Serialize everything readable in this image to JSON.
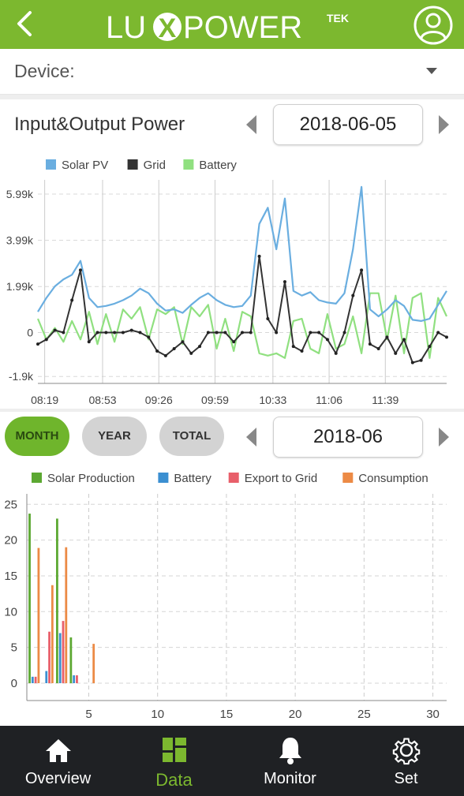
{
  "header": {
    "logo_text": "LUXPOWER",
    "logo_sup": "TEK",
    "brand_color": "#7cb82f"
  },
  "device": {
    "label": "Device:",
    "value": ""
  },
  "io_chart": {
    "title": "Input&Output Power",
    "date": "2018-06-05",
    "legend": [
      {
        "name": "Solar PV",
        "color": "#6aaee0"
      },
      {
        "name": "Grid",
        "color": "#333333"
      },
      {
        "name": "Battery",
        "color": "#90e080"
      }
    ]
  },
  "period": {
    "tabs": [
      {
        "label": "MONTH",
        "active": true
      },
      {
        "label": "YEAR",
        "active": false
      },
      {
        "label": "TOTAL",
        "active": false
      }
    ],
    "date": "2018-06"
  },
  "energy_chart": {
    "legend": [
      {
        "name": "Solar Production",
        "color": "#5ca832"
      },
      {
        "name": "Battery",
        "color": "#3b8fd1"
      },
      {
        "name": "Export to Grid",
        "color": "#e85f6a"
      },
      {
        "name": "Consumption",
        "color": "#ec8a45"
      }
    ]
  },
  "nav": [
    {
      "label": "Overview",
      "icon": "home-icon",
      "active": false
    },
    {
      "label": "Data",
      "icon": "data-icon",
      "active": true
    },
    {
      "label": "Monitor",
      "icon": "bell-icon",
      "active": false
    },
    {
      "label": "Set",
      "icon": "gear-icon",
      "active": false
    }
  ],
  "chart_data": [
    {
      "type": "line",
      "xlabel": "",
      "ylabel": "",
      "x_ticks": [
        "08:19",
        "08:53",
        "09:26",
        "09:59",
        "10:33",
        "11:06",
        "11:39"
      ],
      "y_ticks": [
        "5.99k",
        "3.99k",
        "1.99k",
        "0",
        "-1.9k"
      ],
      "ylim": [
        -2200,
        6400
      ],
      "x_range_minutes": [
        495,
        735
      ],
      "grid": true,
      "legend_position": "top-left",
      "series": [
        {
          "name": "Solar PV",
          "color": "#6aaee0",
          "x": [
            495,
            500,
            505,
            510,
            515,
            520,
            525,
            530,
            535,
            540,
            545,
            550,
            555,
            560,
            565,
            570,
            575,
            580,
            585,
            590,
            595,
            600,
            605,
            610,
            615,
            620,
            625,
            630,
            635,
            640,
            645,
            650,
            655,
            660,
            665,
            670,
            675,
            680,
            685,
            690,
            695,
            700,
            705,
            710,
            715,
            720,
            725,
            730,
            735
          ],
          "y": [
            900,
            1500,
            2000,
            2300,
            2500,
            3100,
            1500,
            1100,
            1150,
            1250,
            1400,
            1600,
            1900,
            1700,
            1250,
            950,
            1000,
            850,
            1200,
            1500,
            1700,
            1400,
            1200,
            1100,
            1150,
            1600,
            4700,
            5400,
            3600,
            5800,
            1800,
            1600,
            1750,
            1400,
            1300,
            1250,
            1700,
            3600,
            6300,
            1000,
            700,
            1000,
            1400,
            1150,
            550,
            500,
            600,
            1200,
            1800
          ]
        },
        {
          "name": "Grid",
          "color": "#333333",
          "x": [
            495,
            500,
            505,
            510,
            515,
            520,
            525,
            530,
            535,
            540,
            545,
            550,
            555,
            560,
            565,
            570,
            575,
            580,
            585,
            590,
            595,
            600,
            605,
            610,
            615,
            620,
            625,
            630,
            635,
            640,
            645,
            650,
            655,
            660,
            665,
            670,
            675,
            680,
            685,
            690,
            695,
            700,
            705,
            710,
            715,
            720,
            725,
            730,
            735
          ],
          "y": [
            -500,
            -300,
            100,
            0,
            1400,
            2700,
            -400,
            0,
            0,
            0,
            0,
            100,
            0,
            -200,
            -800,
            -1000,
            -700,
            -400,
            -900,
            -600,
            0,
            0,
            0,
            -400,
            0,
            0,
            3300,
            600,
            0,
            2200,
            -600,
            -800,
            0,
            0,
            -300,
            -900,
            0,
            1600,
            2700,
            -500,
            -700,
            -200,
            -900,
            -300,
            -1300,
            -1200,
            -600,
            0,
            -200
          ]
        },
        {
          "name": "Battery",
          "color": "#90e080",
          "x": [
            495,
            500,
            505,
            510,
            515,
            520,
            525,
            530,
            535,
            540,
            545,
            550,
            555,
            560,
            565,
            570,
            575,
            580,
            585,
            590,
            595,
            600,
            605,
            610,
            615,
            620,
            625,
            630,
            635,
            640,
            645,
            650,
            655,
            660,
            665,
            670,
            675,
            680,
            685,
            690,
            695,
            700,
            705,
            710,
            715,
            720,
            725,
            730,
            735
          ],
          "y": [
            600,
            -300,
            200,
            -400,
            500,
            -300,
            900,
            -500,
            800,
            -400,
            1000,
            600,
            1100,
            -300,
            1000,
            800,
            1100,
            -500,
            1100,
            700,
            1200,
            -700,
            600,
            -800,
            900,
            700,
            -900,
            -1000,
            -900,
            -1100,
            500,
            600,
            -700,
            -900,
            800,
            -700,
            -500,
            700,
            -900,
            1700,
            1700,
            -300,
            1600,
            -900,
            1500,
            1700,
            -1100,
            1500,
            700
          ]
        }
      ]
    },
    {
      "type": "bar",
      "xlabel": "",
      "ylabel": "",
      "categories": [
        1,
        2,
        3,
        4,
        5
      ],
      "x_ticks": [
        "5",
        "10",
        "15",
        "20",
        "25",
        "30"
      ],
      "y_ticks": [
        "0",
        "5",
        "10",
        "15",
        "20",
        "25"
      ],
      "ylim": [
        0,
        25.8
      ],
      "xlim": [
        0.5,
        31
      ],
      "grid": true,
      "legend_position": "top",
      "series": [
        {
          "name": "Solar Production",
          "color": "#5ca832",
          "values": [
            23.7,
            0,
            23.0,
            6.4,
            0
          ]
        },
        {
          "name": "Battery",
          "color": "#3b8fd1",
          "values": [
            0.9,
            1.7,
            7.0,
            1.1,
            0
          ]
        },
        {
          "name": "Export to Grid",
          "color": "#e85f6a",
          "values": [
            0.9,
            7.2,
            8.7,
            1.1,
            0
          ]
        },
        {
          "name": "Consumption",
          "color": "#ec8a45",
          "values": [
            18.9,
            13.7,
            19.0,
            0,
            5.5
          ]
        }
      ]
    }
  ]
}
